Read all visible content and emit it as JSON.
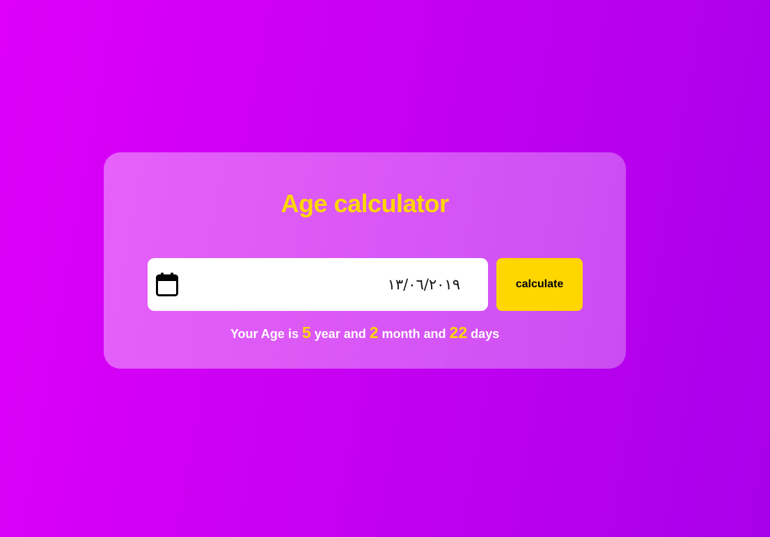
{
  "app": {
    "title": "Age calculator"
  },
  "form": {
    "date_value": "١٣/٠٦/٢٠١٩",
    "calendar_icon": "calendar-icon",
    "calculate_label": "calculate"
  },
  "result": {
    "prefix": "Your Age is",
    "years": "5",
    "year_word": "year and",
    "months": "2",
    "month_word": "month and",
    "days": "22",
    "day_word": "days"
  },
  "colors": {
    "background_start": "#de00f8",
    "background_end": "#a800ea",
    "accent": "#ffd600",
    "text": "#ffffff",
    "input_background": "#ffffff"
  }
}
